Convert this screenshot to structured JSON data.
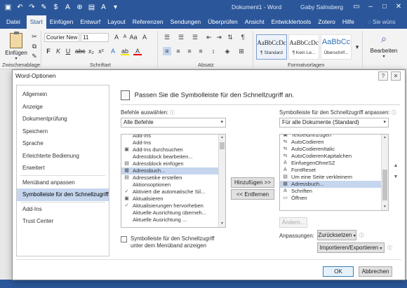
{
  "window": {
    "title": "Dokument1 - Word",
    "user": "Gaby Salnsberg"
  },
  "qat_icons": [
    "save-icon",
    "undo-icon",
    "redo-icon",
    "format-painter-icon",
    "dollar-icon",
    "text-icon",
    "insert-icon",
    "paste-icon",
    "font-icon",
    "customize-icon"
  ],
  "ribbon_tabs": [
    "Datei",
    "Start",
    "Einfügen",
    "Entwurf",
    "Layout",
    "Referenzen",
    "Sendungen",
    "Überprüfen",
    "Ansicht",
    "Entwicklertools",
    "Zotero",
    "Hilfe"
  ],
  "ribbon_active_tab": "Start",
  "tell_me": "Sie wüns",
  "ribbon": {
    "paste_label": "Einfügen",
    "font_name": "Courier New",
    "font_size": "11",
    "styles": [
      {
        "preview": "AaBbCcDc",
        "caption": "¶ Standard"
      },
      {
        "preview": "AaBbCcDc",
        "caption": "¶ Kein Le..."
      },
      {
        "preview": "AaBbCc",
        "caption": "Überschrif..."
      }
    ],
    "edit_label": "Bearbeiten",
    "group_labels": [
      "Zwischenablage",
      "Schriftart",
      "Absatz",
      "Formatvorlagen"
    ]
  },
  "dialog": {
    "title": "Word-Optionen",
    "help": "?",
    "nav": [
      "Allgemein",
      "Anzeige",
      "Dokumentprüfung",
      "Speichern",
      "Sprache",
      "Erleichterte Bedienung",
      "Erweitert",
      "Menüband anpassen",
      "Symbolleiste für den Schnellzugriff",
      "Add-Ins",
      "Trust Center"
    ],
    "active_nav": "Symbolleiste für den Schnellzugriff",
    "heading": "Passen Sie die Symbolleiste für den Schnellzugriff an.",
    "choose_label": "Befehle auswählen:",
    "choose_value": "Alle Befehle",
    "commands": [
      {
        "label": "Add-Ins",
        "icon": ""
      },
      {
        "label": "Add-Ins",
        "icon": ""
      },
      {
        "label": "Add-Ins durchsuchen",
        "icon": "▣"
      },
      {
        "label": "Adressblock bearbeiten...",
        "icon": ""
      },
      {
        "label": "Adressblock einfügen",
        "icon": "▤"
      },
      {
        "label": "Adressbuch...",
        "icon": "▦"
      },
      {
        "label": "Adressetike erstellen",
        "icon": "▤"
      },
      {
        "label": "Aktionsoptionen",
        "icon": ""
      },
      {
        "label": "Aktiviert die automatische Sil...",
        "icon": "✓"
      },
      {
        "label": "Aktualisieren",
        "icon": "▣"
      },
      {
        "label": "Aktualisierungen hervorheben",
        "icon": "✓"
      },
      {
        "label": "Aktuelle Ausrichtung überneh...",
        "icon": ""
      },
      {
        "label": "Aktuelle Ausrichtung ...",
        "icon": ""
      }
    ],
    "commands_selected_index": 5,
    "add_button": "Hinzufügen >>",
    "remove_button": "<< Entfernen",
    "customize_label": "Symbolleiste für den Schnellzugriff anpassen:",
    "customize_value": "Für alle Dokumente (Standard)",
    "qat_list": [
      {
        "label": "Textfeldhinzugen",
        "icon": "▣"
      },
      {
        "label": "AutoCodieren",
        "icon": "⇆"
      },
      {
        "label": "AutoCodierenItalic",
        "icon": "⇆"
      },
      {
        "label": "AutoCodierenKapitalchen",
        "icon": "⇆"
      },
      {
        "label": "EinfuegenOhneSZ",
        "icon": "A"
      },
      {
        "label": "FontReset",
        "icon": "A"
      },
      {
        "label": "Um eine Seite verkleinern",
        "icon": "▤"
      },
      {
        "label": "Adressbuch...",
        "icon": "▦"
      },
      {
        "label": "Schriften",
        "icon": "A"
      },
      {
        "label": "Öffnen",
        "icon": "▭"
      }
    ],
    "qat_selected_index": 7,
    "modify_button": "Ändern...",
    "customizations_label": "Anpassungen:",
    "reset_button": "Zurücksetzen",
    "import_button": "Importieren/Exportieren",
    "show_below_label_1": "Symbolleiste für den Schnellzugriff",
    "show_below_label_2": "unter dem Menüband anzeigen",
    "ok_button": "OK",
    "cancel_button": "Abbrechen"
  },
  "colors": {
    "word_blue": "#2b579a",
    "selection": "#c5d6ee",
    "dialog_border": "#8c8c8c"
  }
}
